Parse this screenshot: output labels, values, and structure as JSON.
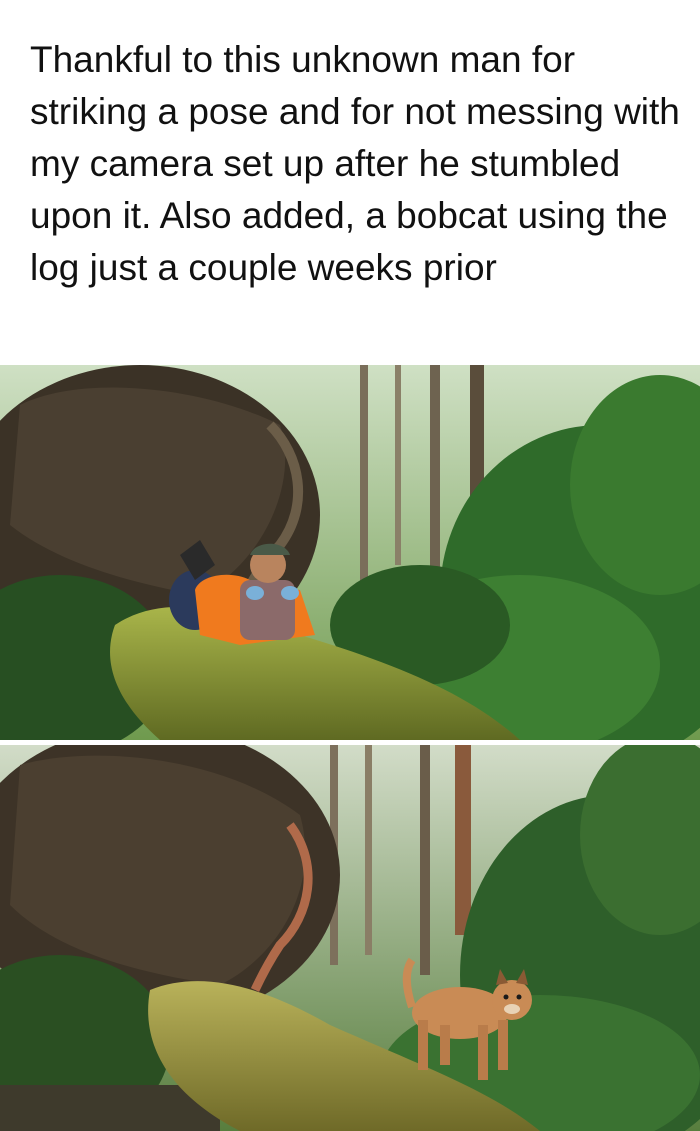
{
  "caption": {
    "text": "Thankful to this unknown man for striking a pose and for not messing with my camera set up after he stumbled upon it. Also added, a bobcat using the log just a couple weeks prior"
  },
  "photos": [
    {
      "subject": "man-lying-on-log",
      "vest_color": "#f07a1e"
    },
    {
      "subject": "bobcat-on-log",
      "fur_color": "#c98b55"
    }
  ],
  "colors": {
    "background": "#ffffff",
    "text": "#111111",
    "moss": "#8a9a32",
    "foliage": "#2f6b2a"
  }
}
